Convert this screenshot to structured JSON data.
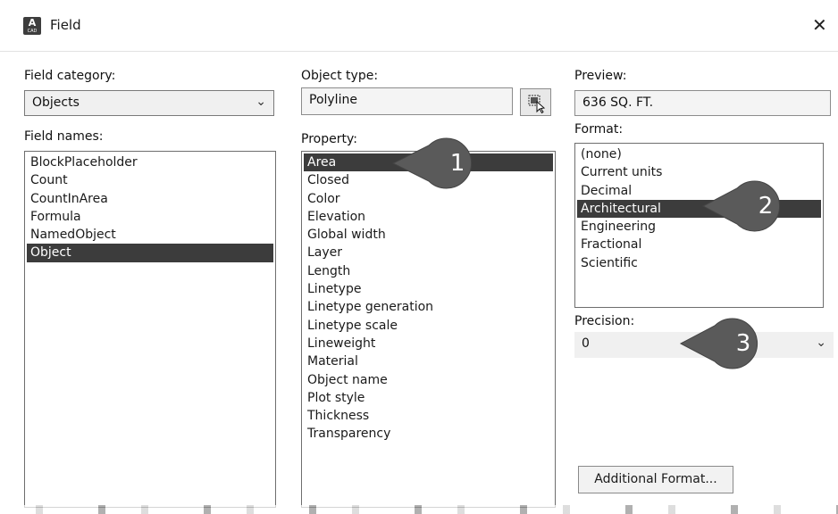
{
  "window": {
    "title": "Field",
    "icon_letter": "A",
    "icon_sub": "CAD",
    "close_symbol": "✕"
  },
  "field_category": {
    "label": "Field category:",
    "value": "Objects"
  },
  "field_names": {
    "label": "Field names:",
    "items": [
      "BlockPlaceholder",
      "Count",
      "CountInArea",
      "Formula",
      "NamedObject",
      "Object"
    ],
    "selected": "Object"
  },
  "object_type": {
    "label": "Object type:",
    "value": "Polyline"
  },
  "property": {
    "label": "Property:",
    "items": [
      "Area",
      "Closed",
      "Color",
      "Elevation",
      "Global width",
      "Layer",
      "Length",
      "Linetype",
      "Linetype generation",
      "Linetype scale",
      "Lineweight",
      "Material",
      "Object name",
      "Plot style",
      "Thickness",
      "Transparency"
    ],
    "selected": "Area"
  },
  "preview": {
    "label": "Preview:",
    "value": "636 SQ. FT."
  },
  "format": {
    "label": "Format:",
    "items": [
      "(none)",
      "Current units",
      "Decimal",
      "Architectural",
      "Engineering",
      "Fractional",
      "Scientific"
    ],
    "selected": "Architectural"
  },
  "precision": {
    "label": "Precision:",
    "value": "0"
  },
  "buttons": {
    "additional_format": "Additional Format..."
  },
  "callouts": [
    "1",
    "2",
    "3"
  ],
  "colors": {
    "selection": "#3c3c3c",
    "callout": "#5a5a5a"
  }
}
